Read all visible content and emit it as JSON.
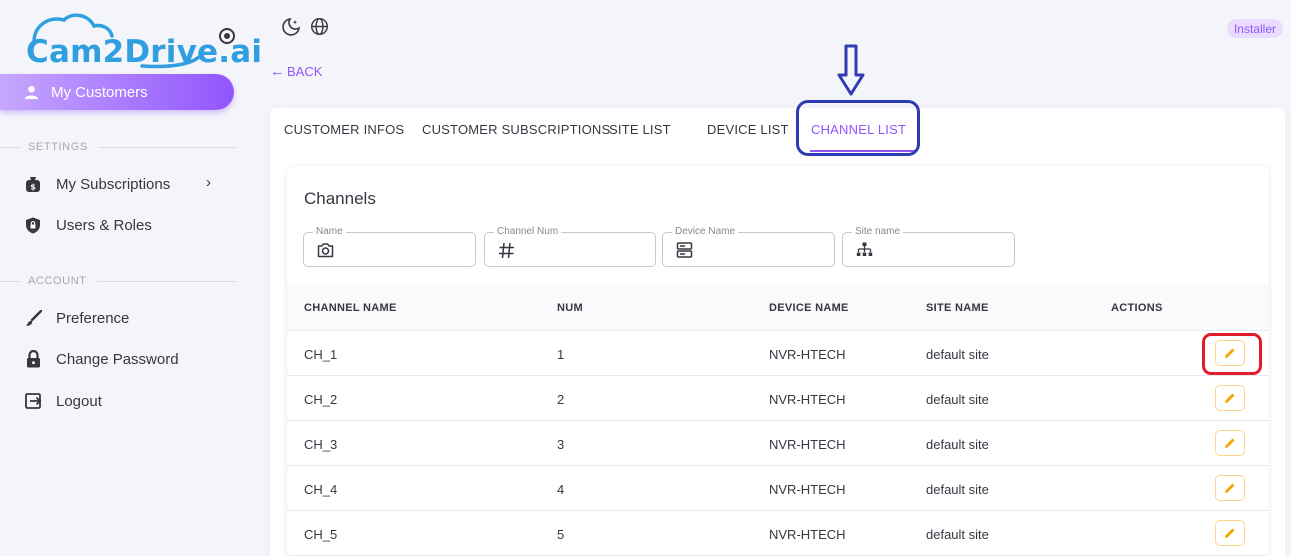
{
  "brand": {
    "logo_text": "Cam2Drive.ai"
  },
  "sidebar": {
    "active_item": {
      "label": "My Customers",
      "icon": "person-icon"
    },
    "sections": [
      {
        "label": "SETTINGS"
      },
      {
        "label": "ACCOUNT"
      }
    ],
    "items": [
      {
        "label": "My Subscriptions",
        "icon": "money-bag-icon",
        "has_chevron": true
      },
      {
        "label": "Users & Roles",
        "icon": "shield-lock-icon"
      },
      {
        "label": "Preference",
        "icon": "brush-icon"
      },
      {
        "label": "Change Password",
        "icon": "lock-icon"
      },
      {
        "label": "Logout",
        "icon": "logout-icon"
      }
    ]
  },
  "topbar": {
    "theme_icon": "theme-toggle-icon",
    "language_icon": "globe-icon",
    "role_badge": "Installer"
  },
  "back": {
    "label": "BACK"
  },
  "tabs": [
    {
      "label": "CUSTOMER INFOS"
    },
    {
      "label": "CUSTOMER SUBSCRIPTIONS"
    },
    {
      "label": "SITE LIST"
    },
    {
      "label": "DEVICE LIST"
    },
    {
      "label": "CHANNEL LIST",
      "active": true
    }
  ],
  "panel": {
    "title": "Channels",
    "filters": [
      {
        "label": "Name",
        "icon": "camera-icon"
      },
      {
        "label": "Channel Num",
        "icon": "hash-icon"
      },
      {
        "label": "Device Name",
        "icon": "server-icon"
      },
      {
        "label": "Site name",
        "icon": "sitemap-icon"
      }
    ],
    "columns": [
      "CHANNEL NAME",
      "NUM",
      "DEVICE NAME",
      "SITE NAME",
      "ACTIONS"
    ],
    "rows": [
      {
        "name": "CH_1",
        "num": "1",
        "device": "NVR-HTECH",
        "site": "default site"
      },
      {
        "name": "CH_2",
        "num": "2",
        "device": "NVR-HTECH",
        "site": "default site"
      },
      {
        "name": "CH_3",
        "num": "3",
        "device": "NVR-HTECH",
        "site": "default site"
      },
      {
        "name": "CH_4",
        "num": "4",
        "device": "NVR-HTECH",
        "site": "default site"
      },
      {
        "name": "CH_5",
        "num": "5",
        "device": "NVR-HTECH",
        "site": "default site"
      }
    ]
  },
  "colors": {
    "accent": "#9155fd",
    "annotation_blue": "#2e3bb3",
    "annotation_red": "#e01e2b",
    "edit_icon": "#f5a300",
    "logo": "#2f9fe0"
  }
}
